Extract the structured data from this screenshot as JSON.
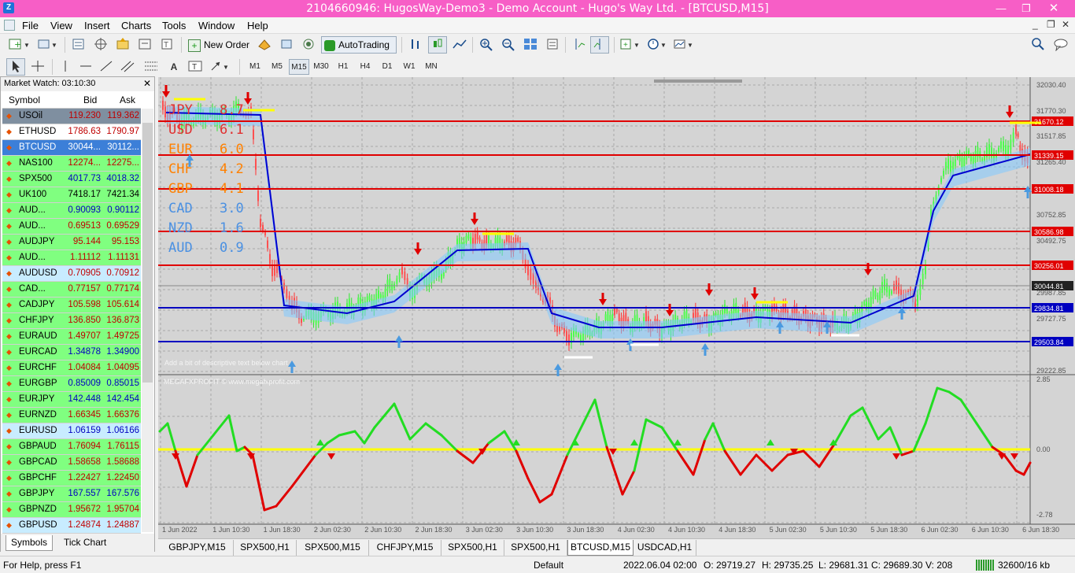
{
  "window": {
    "title": "2104660946: HugosWay-Demo3 - Demo Account - Hugo's Way Ltd. - [BTCUSD,M15]",
    "app_icon": "Z"
  },
  "menu": [
    "File",
    "View",
    "Insert",
    "Charts",
    "Tools",
    "Window",
    "Help"
  ],
  "toolbar": {
    "new_order": "New Order",
    "autotrading": "AutoTrading"
  },
  "timeframes": [
    "M1",
    "M5",
    "M15",
    "M30",
    "H1",
    "H4",
    "D1",
    "W1",
    "MN"
  ],
  "active_timeframe": "M15",
  "market_watch": {
    "title": "Market Watch: 03:10:30",
    "col_symbol": "Symbol",
    "col_bid": "Bid",
    "col_ask": "Ask",
    "rows": [
      {
        "symbol": "USOil",
        "bid": "119.230",
        "ask": "119.362",
        "bg": "#7f8fa0",
        "color": "#c00000"
      },
      {
        "symbol": "ETHUSD",
        "bid": "1786.63",
        "ask": "1790.97",
        "bg": "#ffffff",
        "color": "#c00000"
      },
      {
        "symbol": "BTCUSD",
        "bid": "30044...",
        "ask": "30112...",
        "bg": "#3c7fd8",
        "color": "#ffffff"
      },
      {
        "symbol": "NAS100",
        "bid": "12274...",
        "ask": "12275...",
        "bg": "#80ff80",
        "color": "#c00000"
      },
      {
        "symbol": "SPX500",
        "bid": "4017.73",
        "ask": "4018.32",
        "bg": "#80ff80",
        "color": "#0000c0"
      },
      {
        "symbol": "UK100",
        "bid": "7418.17",
        "ask": "7421.34",
        "bg": "#80ff80",
        "color": "#000000"
      },
      {
        "symbol": "AUD...",
        "bid": "0.90093",
        "ask": "0.90112",
        "bg": "#80ff80",
        "color": "#0000c0"
      },
      {
        "symbol": "AUD...",
        "bid": "0.69513",
        "ask": "0.69529",
        "bg": "#80ff80",
        "color": "#c00000"
      },
      {
        "symbol": "AUDJPY",
        "bid": "95.144",
        "ask": "95.153",
        "bg": "#80ff80",
        "color": "#c00000"
      },
      {
        "symbol": "AUD...",
        "bid": "1.11112",
        "ask": "1.11131",
        "bg": "#80ff80",
        "color": "#c00000"
      },
      {
        "symbol": "AUDUSD",
        "bid": "0.70905",
        "ask": "0.70912",
        "bg": "#c8ecff",
        "color": "#c00000"
      },
      {
        "symbol": "CAD...",
        "bid": "0.77157",
        "ask": "0.77174",
        "bg": "#80ff80",
        "color": "#c00000"
      },
      {
        "symbol": "CADJPY",
        "bid": "105.598",
        "ask": "105.614",
        "bg": "#80ff80",
        "color": "#c00000"
      },
      {
        "symbol": "CHFJPY",
        "bid": "136.850",
        "ask": "136.873",
        "bg": "#80ff80",
        "color": "#c00000"
      },
      {
        "symbol": "EURAUD",
        "bid": "1.49707",
        "ask": "1.49725",
        "bg": "#80ff80",
        "color": "#c00000"
      },
      {
        "symbol": "EURCAD",
        "bid": "1.34878",
        "ask": "1.34900",
        "bg": "#80ff80",
        "color": "#0000c0"
      },
      {
        "symbol": "EURCHF",
        "bid": "1.04084",
        "ask": "1.04095",
        "bg": "#80ff80",
        "color": "#c00000"
      },
      {
        "symbol": "EURGBP",
        "bid": "0.85009",
        "ask": "0.85015",
        "bg": "#80ff80",
        "color": "#0000c0"
      },
      {
        "symbol": "EURJPY",
        "bid": "142.448",
        "ask": "142.454",
        "bg": "#80ff80",
        "color": "#0000c0"
      },
      {
        "symbol": "EURNZD",
        "bid": "1.66345",
        "ask": "1.66376",
        "bg": "#80ff80",
        "color": "#c00000"
      },
      {
        "symbol": "EURUSD",
        "bid": "1.06159",
        "ask": "1.06166",
        "bg": "#c8ecff",
        "color": "#0000c0"
      },
      {
        "symbol": "GBPAUD",
        "bid": "1.76094",
        "ask": "1.76115",
        "bg": "#80ff80",
        "color": "#c00000"
      },
      {
        "symbol": "GBPCAD",
        "bid": "1.58658",
        "ask": "1.58688",
        "bg": "#80ff80",
        "color": "#c00000"
      },
      {
        "symbol": "GBPCHF",
        "bid": "1.22427",
        "ask": "1.22450",
        "bg": "#80ff80",
        "color": "#c00000"
      },
      {
        "symbol": "GBPJPY",
        "bid": "167.557",
        "ask": "167.576",
        "bg": "#80ff80",
        "color": "#0000c0"
      },
      {
        "symbol": "GBPNZD",
        "bid": "1.95672",
        "ask": "1.95704",
        "bg": "#80ff80",
        "color": "#c00000"
      },
      {
        "symbol": "GBPUSD",
        "bid": "1.24874",
        "ask": "1.24887",
        "bg": "#c8ecff",
        "color": "#c00000"
      }
    ],
    "tabs": [
      "Symbols",
      "Tick Chart"
    ]
  },
  "chart": {
    "strength_labels": [
      {
        "cur": "JPY",
        "val": "8.7",
        "color": "#e03030"
      },
      {
        "cur": "USD",
        "val": "6.1",
        "color": "#e03030"
      },
      {
        "cur": "EUR",
        "val": "6.0",
        "color": "#ff8000"
      },
      {
        "cur": "CHF",
        "val": "4.2",
        "color": "#ff8000"
      },
      {
        "cur": "GBP",
        "val": "4.1",
        "color": "#ff8000"
      },
      {
        "cur": "CAD",
        "val": "3.0",
        "color": "#4a90e2"
      },
      {
        "cur": "NZD",
        "val": "1.6",
        "color": "#4a90e2"
      },
      {
        "cur": "AUD",
        "val": "0.9",
        "color": "#4a90e2"
      }
    ],
    "indicator_caption": "MEGAFXPROFIT © www.megafxprofit.com",
    "bottom_note": "Add a bit of descriptive text below chart",
    "price_scale": [
      "32030.40",
      "31770.30",
      "31517.85",
      "31265.40",
      "30752.85",
      "30492.75",
      "29987.85",
      "29727.75",
      "29222.85"
    ],
    "level_labels": [
      {
        "price": "31670.12",
        "color": "#e00000"
      },
      {
        "price": "31339.15",
        "color": "#e00000"
      },
      {
        "price": "31008.18",
        "color": "#e00000"
      },
      {
        "price": "30586.98",
        "color": "#e00000"
      },
      {
        "price": "30256.01",
        "color": "#e00000"
      },
      {
        "price": "30044.81",
        "color": "#222222"
      },
      {
        "price": "29834.81",
        "color": "#0000c0"
      },
      {
        "price": "29503.84",
        "color": "#0000c0"
      }
    ],
    "osc_scale": [
      "2.85",
      "0.00",
      "-2.78"
    ],
    "time_labels": [
      "1 Jun 2022",
      "1 Jun 10:30",
      "1 Jun 18:30",
      "2 Jun 02:30",
      "2 Jun 10:30",
      "2 Jun 18:30",
      "3 Jun 02:30",
      "3 Jun 10:30",
      "3 Jun 18:30",
      "4 Jun 02:30",
      "4 Jun 10:30",
      "4 Jun 18:30",
      "5 Jun 02:30",
      "5 Jun 10:30",
      "5 Jun 18:30",
      "6 Jun 02:30",
      "6 Jun 10:30",
      "6 Jun 18:30"
    ]
  },
  "chart_tabs": [
    "GBPJPY,M15",
    "SPX500,H1",
    "SPX500,M15",
    "CHFJPY,M15",
    "SPX500,H1",
    "SPX500,H1",
    "BTCUSD,M15",
    "USDCAD,H1"
  ],
  "active_chart_tab": "BTCUSD,M15",
  "status": {
    "help": "For Help, press F1",
    "profile": "Default",
    "datetime": "2022.06.04 02:00",
    "open": "O: 29719.27",
    "high": "H: 29735.25",
    "low": "L: 29681.31",
    "close": "C: 29689.30",
    "volume": "V: 208",
    "traffic": "32600/16 kb"
  }
}
